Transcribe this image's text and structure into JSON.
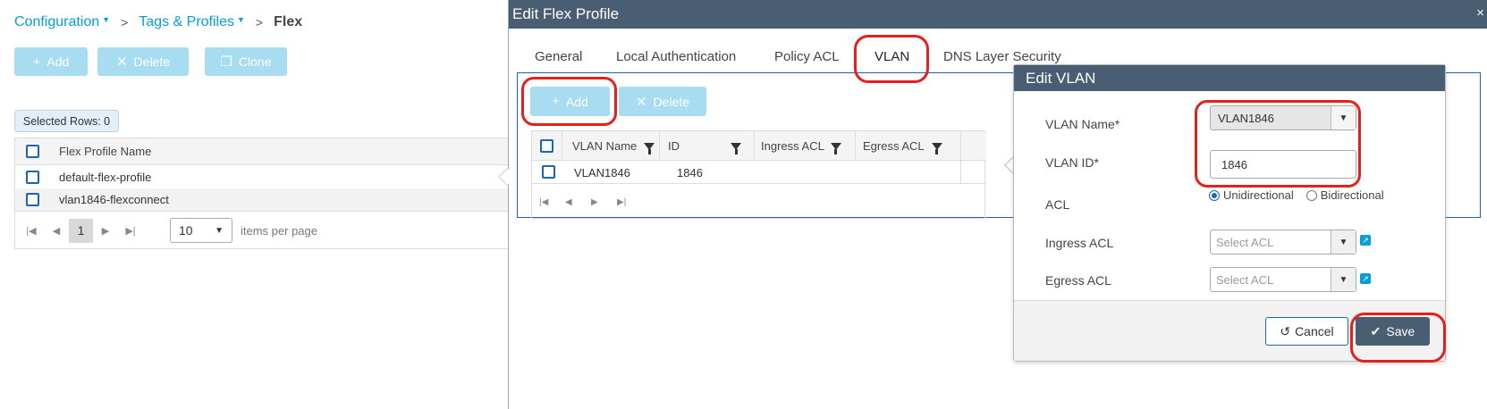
{
  "breadcrumb": {
    "configuration": "Configuration",
    "tags_profiles": "Tags & Profiles",
    "current": "Flex",
    "separator": ">"
  },
  "toolbar": {
    "add_label": "Add",
    "delete_label": "Delete",
    "clone_label": "Clone"
  },
  "selected_rows": "Selected Rows: 0",
  "flex_grid": {
    "header": "Flex Profile Name",
    "rows": [
      "default-flex-profile",
      "vlan1846-flexconnect"
    ]
  },
  "pager": {
    "current_page": "1",
    "page_size": "10",
    "items_label": "items per page"
  },
  "modal": {
    "title": "Edit Flex Profile",
    "close": "×",
    "tabs": [
      "General",
      "Local Authentication",
      "Policy ACL",
      "VLAN",
      "DNS Layer Security"
    ],
    "active_tab": "VLAN",
    "add_label": "Add",
    "delete_label": "Delete",
    "vlan_grid": {
      "headers": [
        "VLAN Name",
        "ID",
        "Ingress ACL",
        "Egress ACL"
      ],
      "rows": [
        {
          "name": "VLAN1846",
          "id": "1846",
          "ingress": "",
          "egress": ""
        }
      ]
    }
  },
  "edit_vlan": {
    "title": "Edit VLAN",
    "vlan_name_label": "VLAN Name*",
    "vlan_name_value": "VLAN1846",
    "vlan_id_label": "VLAN ID*",
    "vlan_id_value": "1846",
    "acl_label": "ACL",
    "acl_options": [
      "Unidirectional",
      "Bidirectional"
    ],
    "acl_selected": "Unidirectional",
    "ingress_label": "Ingress ACL",
    "ingress_placeholder": "Select ACL",
    "egress_label": "Egress ACL",
    "egress_placeholder": "Select ACL",
    "cancel_label": "Cancel",
    "save_label": "Save"
  },
  "colors": {
    "accent": "#049fd9",
    "header_bg": "#495e72",
    "disabled_btn": "#a8dcf0",
    "highlight_ring": "#e5201c"
  }
}
